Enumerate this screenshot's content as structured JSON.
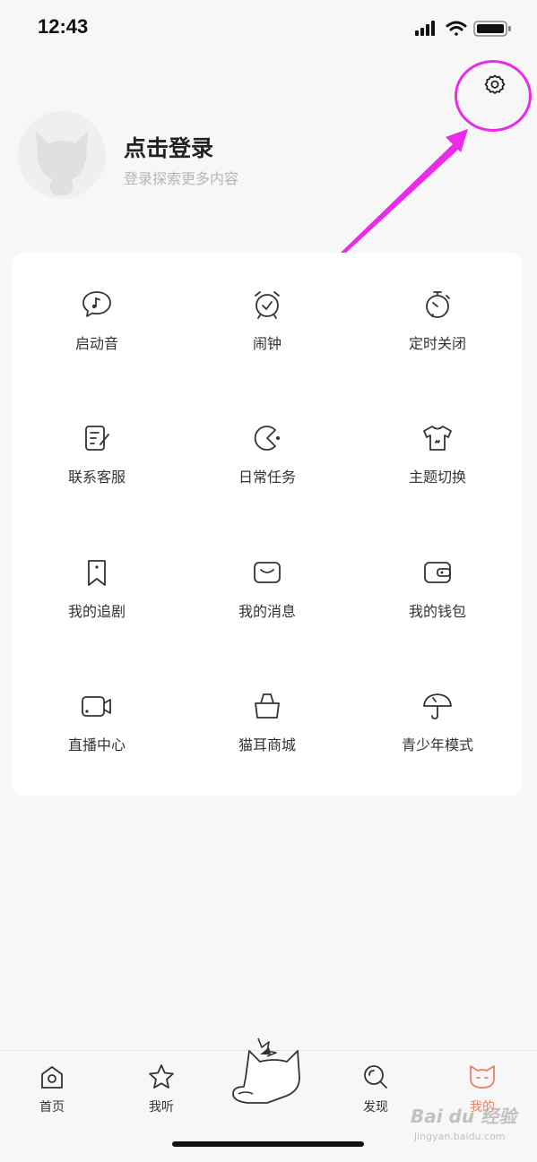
{
  "status_bar": {
    "time": "12:43"
  },
  "profile": {
    "title": "点击登录",
    "subtitle": "登录探索更多内容"
  },
  "menu": [
    {
      "label": "启动音",
      "icon": "music-bubble-icon"
    },
    {
      "label": "闹钟",
      "icon": "alarm-clock-icon"
    },
    {
      "label": "定时关闭",
      "icon": "timer-icon"
    },
    {
      "label": "联系客服",
      "icon": "edit-note-icon"
    },
    {
      "label": "日常任务",
      "icon": "pacman-icon"
    },
    {
      "label": "主题切换",
      "icon": "tshirt-icon"
    },
    {
      "label": "我的追剧",
      "icon": "bookmark-icon"
    },
    {
      "label": "我的消息",
      "icon": "envelope-icon"
    },
    {
      "label": "我的钱包",
      "icon": "wallet-icon"
    },
    {
      "label": "直播中心",
      "icon": "video-camera-icon"
    },
    {
      "label": "猫耳商城",
      "icon": "shopping-bag-icon"
    },
    {
      "label": "青少年模式",
      "icon": "umbrella-icon"
    }
  ],
  "tabbar": {
    "home": "首页",
    "listen": "我听",
    "discover": "发现",
    "mine": "我的"
  },
  "watermark": {
    "main": "Bai du 经验",
    "sub": "jingyan.baidu.com"
  },
  "colors": {
    "accent": "#e8826a",
    "highlight": "#ea2bea"
  }
}
